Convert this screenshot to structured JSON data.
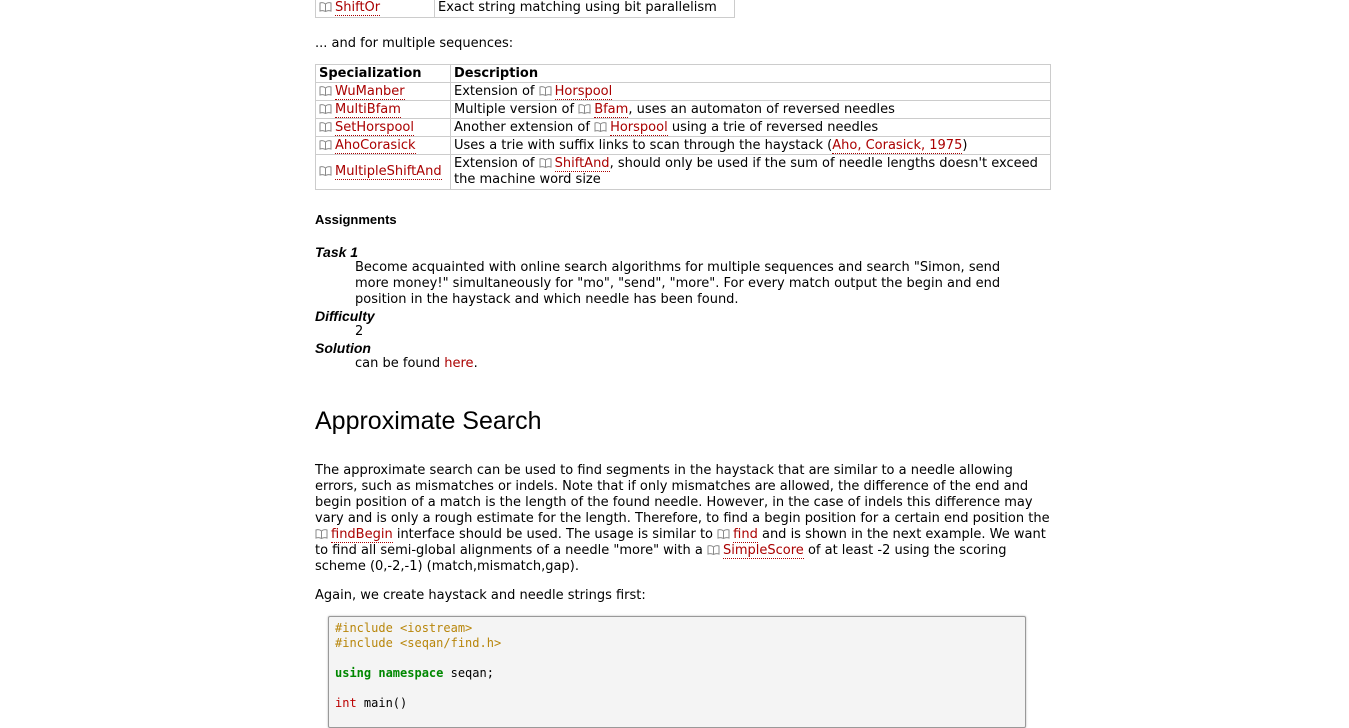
{
  "table_top": {
    "rows": [
      {
        "name": "ShiftOr",
        "desc": "Exact string matching using bit parallelism"
      }
    ]
  },
  "intro_multi": "... and for multiple sequences:",
  "table_multi": {
    "headers": [
      "Specialization",
      "Description"
    ],
    "rows": [
      {
        "name": "WuManber",
        "pre": "Extension of ",
        "link": "Horspool",
        "post": ""
      },
      {
        "name": "MultiBfam",
        "pre": "Multiple version of ",
        "link": "Bfam",
        "post": ", uses an automaton of reversed needles"
      },
      {
        "name": "SetHorspool",
        "pre": "Another extension of ",
        "link": "Horspool",
        "post": " using a trie of reversed needles"
      },
      {
        "name": "AhoCorasick",
        "pre": "Uses a trie with suffix links to scan through the haystack (",
        "link": "Aho, Corasick, 1975",
        "post": ")"
      },
      {
        "name": "MultipleShiftAnd",
        "pre": "Extension of ",
        "link": "ShiftAnd",
        "post": ", should only be used if the sum of needle lengths doesn't exceed the machine word size"
      }
    ]
  },
  "assignments_title": "Assignments",
  "task": {
    "task_label": "Task 1",
    "task_text": "Become acquainted with online search algorithms for multiple sequences and search \"Simon, send more money!\" simultaneously for \"mo\", \"send\", \"more\". For every match output the begin and end position in the haystack and which needle has been found.",
    "difficulty_label": "Difficulty",
    "difficulty_value": "2",
    "solution_label": "Solution",
    "solution_pre": "can be found ",
    "solution_link": "here",
    "solution_post": "."
  },
  "section_title": "Approximate Search",
  "paragraph": {
    "p1": "The approximate search can be used to find segments in the haystack that are similar to a needle allowing errors, such as mismatches or indels. Note that if only mismatches are allowed, the difference of the end and begin position of a match is the length of the found needle. However, in the case of indels this difference may vary and is only a rough estimate for the length. Therefore, to find a begin position for a certain end position the ",
    "link1": "findBegin",
    "p2": " interface should be used. The usage is similar to ",
    "link2": "find",
    "p3": " and is shown in the next example. We want to find all semi-global alignments of a needle \"more\" with a ",
    "link3": "SimpleScore",
    "p4": " of at least -2 using the scoring scheme (0,-2,-1) (match,mismatch,gap)."
  },
  "paragraph2": "Again, we create haystack and needle strings first:",
  "code": {
    "line1": "#include <iostream>",
    "line2": "#include <seqan/find.h>",
    "line3_kw": "using namespace",
    "line3_rest": " seqan;",
    "line4_type": "int",
    "line4_rest": " main()"
  }
}
